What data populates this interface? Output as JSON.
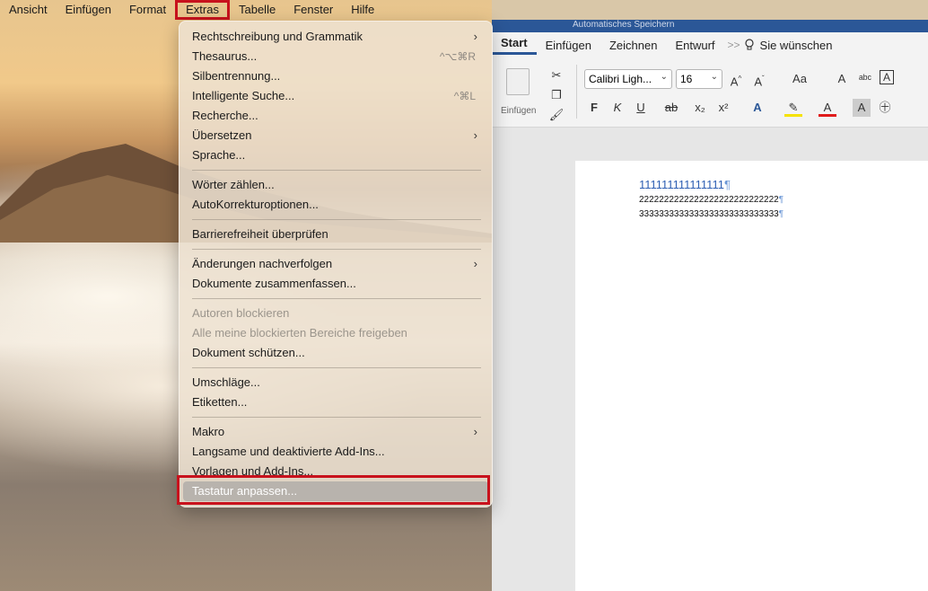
{
  "menubar": {
    "items": [
      "Ansicht",
      "Einfügen",
      "Format",
      "Extras",
      "Tabelle",
      "Fenster",
      "Hilfe"
    ]
  },
  "menu": {
    "items": [
      {
        "label": "Rechtschreibung und Grammatik",
        "submenu": true
      },
      {
        "label": "Thesaurus...",
        "shortcut": "^⌥⌘R"
      },
      {
        "label": "Silbentrennung..."
      },
      {
        "label": "Intelligente Suche...",
        "shortcut": "^⌘L"
      },
      {
        "label": "Recherche..."
      },
      {
        "label": "Übersetzen",
        "submenu": true
      },
      {
        "label": "Sprache..."
      },
      {
        "label": "Wörter zählen..."
      },
      {
        "label": "AutoKorrekturoptionen..."
      },
      {
        "label": "Barrierefreiheit überprüfen"
      },
      {
        "label": "Änderungen nachverfolgen",
        "submenu": true
      },
      {
        "label": "Dokumente zusammenfassen..."
      },
      {
        "label": "Autoren blockieren",
        "disabled": true
      },
      {
        "label": "Alle meine blockierten Bereiche freigeben",
        "disabled": true
      },
      {
        "label": "Dokument schützen..."
      },
      {
        "label": "Umschläge..."
      },
      {
        "label": "Etiketten..."
      },
      {
        "label": "Makro",
        "submenu": true
      },
      {
        "label": "Langsame und deaktivierte Add-Ins..."
      },
      {
        "label": "Vorlagen und Add-Ins..."
      },
      {
        "label": "Tastatur anpassen...",
        "selected": true
      }
    ]
  },
  "word": {
    "title": "Automatisches Speichern",
    "tabs": [
      "Start",
      "Einfügen",
      "Zeichnen",
      "Entwurf"
    ],
    "more": ">>",
    "search_label": "Sie wünschen",
    "paste_label": "Einfügen",
    "font_name": "Calibri Ligh...",
    "font_size": "16",
    "format_buttons": [
      "F",
      "K",
      "U",
      "ab",
      "x₂",
      "x²",
      "A",
      "Aa",
      "A"
    ],
    "doc_lines": [
      "111111111111111",
      "2222222222222222222222222222",
      "3333333333333333333333333333"
    ],
    "pilcrow": "¶"
  },
  "colors": {
    "highlight_outline": "#c8121d",
    "word_blue": "#2b5797",
    "selected_item": "#b8b3ad"
  }
}
